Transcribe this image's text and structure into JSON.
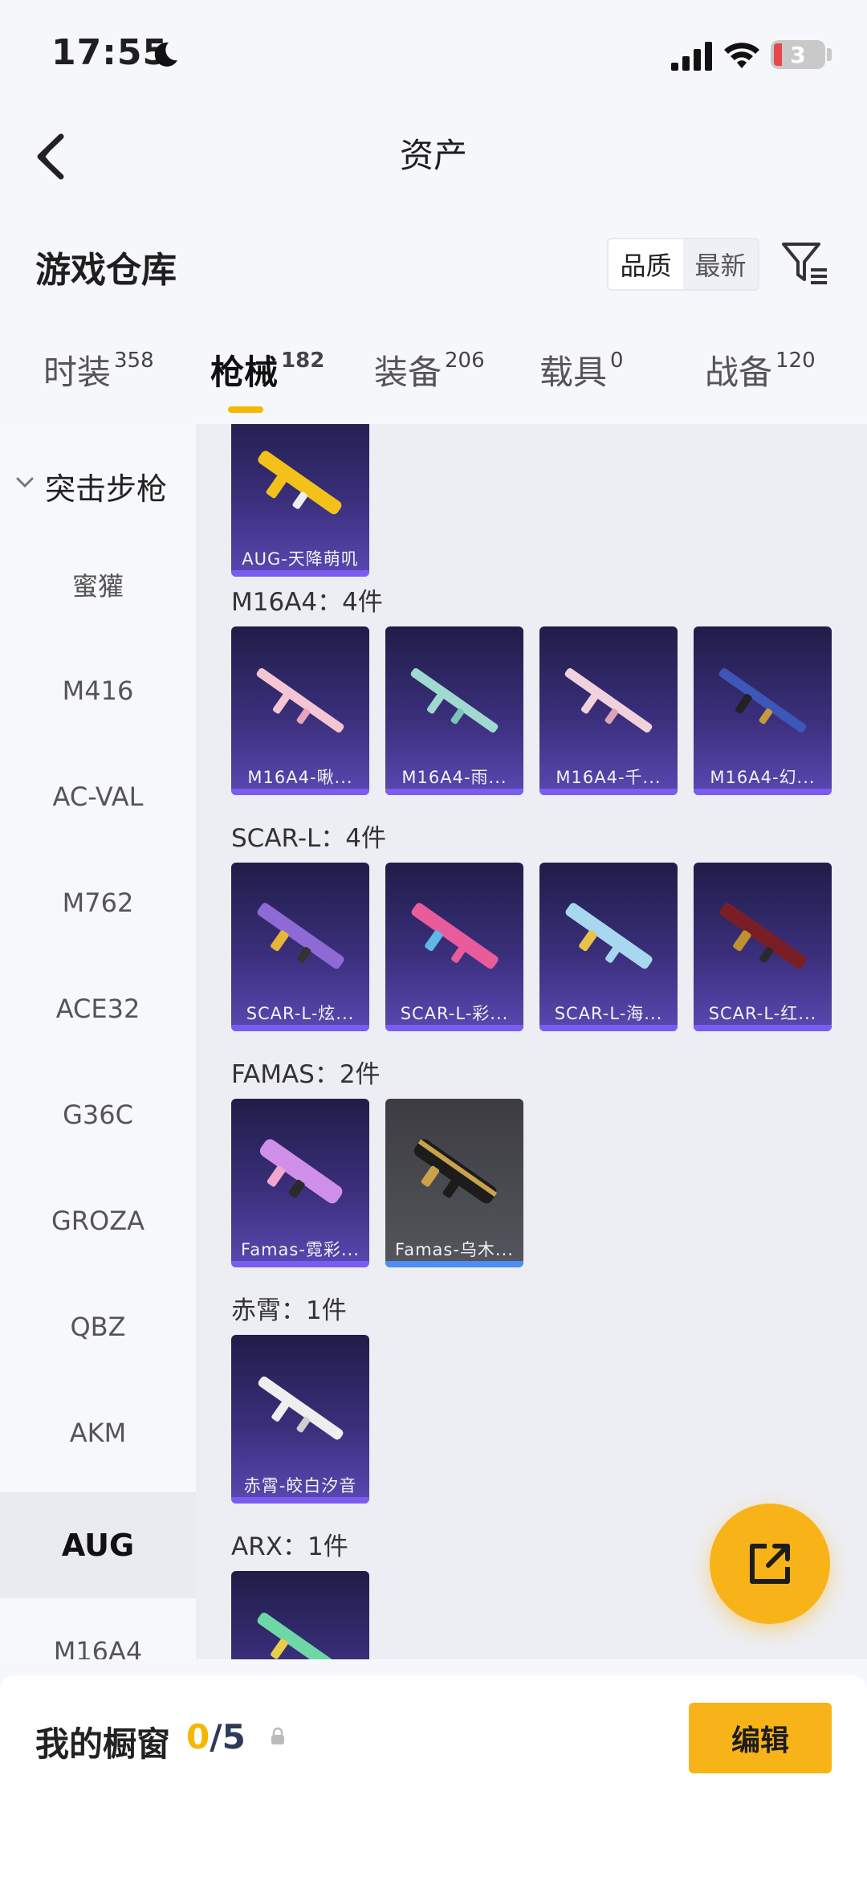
{
  "status_bar": {
    "time": "17:55",
    "battery": "3"
  },
  "nav": {
    "title": "资产"
  },
  "warehouse": {
    "title": "游戏仓库",
    "sort_options": [
      "品质",
      "最新"
    ]
  },
  "tabs": [
    {
      "label": "时装",
      "count": "358"
    },
    {
      "label": "枪械",
      "count": "182"
    },
    {
      "label": "装备",
      "count": "206"
    },
    {
      "label": "载具",
      "count": "0"
    },
    {
      "label": "战备",
      "count": "120"
    }
  ],
  "sidebar": {
    "group": "突击步枪",
    "items": [
      "蜜獾",
      "M416",
      "AC-VAL",
      "M762",
      "ACE32",
      "G36C",
      "GROZA",
      "QBZ",
      "AKM",
      "AUG",
      "M16A4"
    ]
  },
  "content": {
    "top_card": "AUG-天降萌叽",
    "groups": [
      {
        "title": "M16A4：4件",
        "cards": [
          "M16A4-啾...",
          "M16A4-雨...",
          "M16A4-千...",
          "M16A4-幻..."
        ]
      },
      {
        "title": "SCAR-L：4件",
        "cards": [
          "SCAR-L-炫...",
          "SCAR-L-彩...",
          "SCAR-L-海...",
          "SCAR-L-红..."
        ]
      },
      {
        "title": "FAMAS：2件",
        "cards": [
          "Famas-霓彩...",
          "Famas-乌木..."
        ]
      },
      {
        "title": "赤霄：1件",
        "cards": [
          "赤霄-皎白汐音"
        ]
      },
      {
        "title": "ARX：1件",
        "cards": []
      }
    ]
  },
  "bottom": {
    "window_label": "我的橱窗",
    "window_current": "0",
    "window_total": "/5",
    "edit_label": "编辑"
  },
  "colors": {
    "accent": "#f8b319",
    "card_purple": "#3b2f7c",
    "active_underline": "#f5b800"
  }
}
